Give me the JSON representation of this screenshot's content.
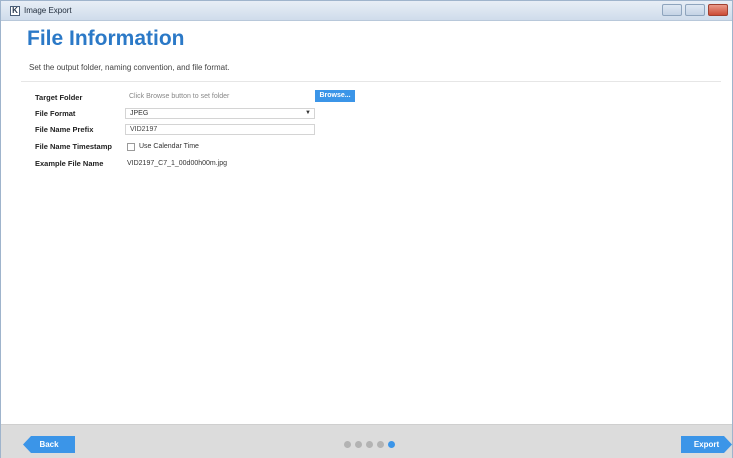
{
  "window": {
    "title": "Image Export",
    "app_icon_glyph": "K",
    "controls": [
      "minimize-icon",
      "maximize-icon",
      "close-icon"
    ]
  },
  "page": {
    "title": "File Information",
    "subtitle": "Set the output folder, naming convention, and file format."
  },
  "form": {
    "target_folder": {
      "label": "Target Folder",
      "hint": "Click Browse button to set folder",
      "button_label": "Browse..."
    },
    "file_format": {
      "label": "File Format",
      "selected": "JPEG"
    },
    "file_name_prefix": {
      "label": "File Name Prefix",
      "value": "VID2197"
    },
    "file_name_timestamp": {
      "label": "File Name Timestamp",
      "checkbox_label": "Use Calendar Time",
      "checked": false
    },
    "example_file_name": {
      "label": "Example File Name",
      "value": "VID2197_C7_1_00d00h00m.jpg"
    }
  },
  "footer": {
    "back_label": "Back",
    "export_label": "Export",
    "steps_total": 5,
    "current_step": 5
  },
  "colors": {
    "accent": "#3b95e8",
    "title": "#2b79c7",
    "footer_bg": "#dcdcdc"
  }
}
